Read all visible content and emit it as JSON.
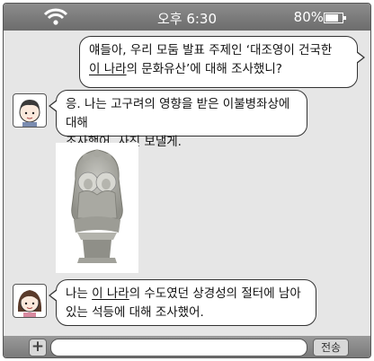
{
  "status": {
    "time": "오후 6:30",
    "battery_percent": "80%",
    "battery_level": 0.8
  },
  "messages": [
    {
      "line1": "얘들아, 우리 모둠 발표 주제인 ‘대조영이 건국한",
      "line2_underlined": "이 나라",
      "line2_rest": "의 문화유산’에 대해 조사했니?"
    },
    {
      "line1": "응. 나는 고구려의 영향을 받은 이불병좌상에 대해",
      "line2": "조사했어. 사진 보낼게."
    },
    {
      "line1_prefix": "나는 ",
      "line1_underlined": "이 나라",
      "line1_rest": "의 수도였던 상경성의 절터에 남아",
      "line2": "있는 석등에 대해 조사했어."
    }
  ],
  "input": {
    "plus_label": "+",
    "send_label": "전송"
  },
  "icons": {
    "wifi": "wifi-icon",
    "battery": "battery-icon",
    "plus": "plus-icon",
    "avatar_boy": "boy-avatar-icon",
    "avatar_girl": "girl-avatar-icon"
  }
}
